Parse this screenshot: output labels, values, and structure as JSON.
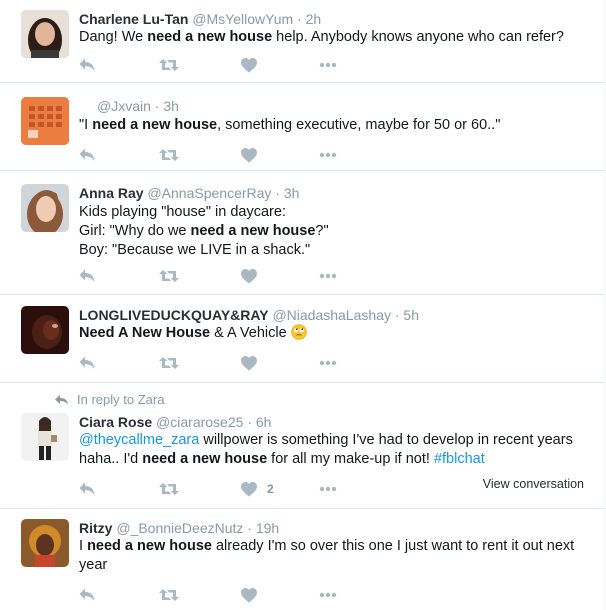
{
  "tweets": [
    {
      "fullname": "Charlene Lu-Tan",
      "handle": "@MsYellowYum",
      "separator": "·",
      "time": "2h",
      "body": [
        {
          "t": "Dang! We "
        },
        {
          "t": "need a new house",
          "b": true
        },
        {
          "t": " help. Anybody knows anyone who can refer?"
        }
      ],
      "icons": [
        "reply-icon",
        "retweet-icon",
        "heart-icon",
        "more-icon"
      ]
    },
    {
      "fullname": "",
      "handle": "@Jxvain",
      "separator": "·",
      "time": "3h",
      "body": [
        {
          "t": "\"I "
        },
        {
          "t": "need a new house",
          "b": true
        },
        {
          "t": ", something executive, maybe for 50 or 60..\""
        }
      ],
      "icons": [
        "reply-icon",
        "retweet-icon",
        "heart-icon",
        "more-icon"
      ]
    },
    {
      "fullname": "Anna Ray",
      "handle": "@AnnaSpencerRay",
      "separator": "·",
      "time": "3h",
      "body_lines": [
        [
          {
            "t": "Kids playing \"house\" in daycare:"
          }
        ],
        [
          {
            "t": "Girl: \"Why do we "
          },
          {
            "t": "need a new house",
            "b": true
          },
          {
            "t": "?\""
          }
        ],
        [
          {
            "t": "Boy: \"Because we LIVE in a shack.\""
          }
        ]
      ],
      "icons": [
        "reply-icon",
        "retweet-icon",
        "heart-icon",
        "more-icon"
      ]
    },
    {
      "fullname": "LONGLIVEDUCKQUAY&RAY",
      "handle": "@NiadashaLashay",
      "separator": "·",
      "time": "5h",
      "body": [
        {
          "t": "Need A New House",
          "b": true
        },
        {
          "t": " & A Vehicle "
        }
      ],
      "emoji": "rolling-eyes-emoji",
      "icons": [
        "reply-icon",
        "retweet-icon",
        "heart-icon",
        "more-icon"
      ]
    },
    {
      "context": "In reply to Zara",
      "fullname": "Ciara Rose",
      "handle": "@ciararose25",
      "separator": "·",
      "time": "6h",
      "body": [
        {
          "t": "@theycallme_zara",
          "link": true
        },
        {
          "t": " willpower is something I've had to develop in recent years haha.. I'd "
        },
        {
          "t": "need a new house",
          "b": true
        },
        {
          "t": " for all my make-up if not! "
        },
        {
          "t": "#fblchat",
          "link": true
        }
      ],
      "like_count": "2",
      "view_conversation": "View conversation",
      "icons": [
        "reply-icon",
        "retweet-icon",
        "heart-icon",
        "more-icon"
      ]
    },
    {
      "fullname": "Ritzy",
      "handle": "@_BonnieDeezNutz",
      "separator": "·",
      "time": "19h",
      "body": [
        {
          "t": "I "
        },
        {
          "t": "need a new house",
          "b": true
        },
        {
          "t": " already I'm so over this one I just want to rent it out next year"
        }
      ],
      "icons": [
        "reply-icon",
        "retweet-icon",
        "heart-icon",
        "more-icon"
      ]
    }
  ],
  "colors": {
    "icon": "#aab8c2",
    "muted": "#8899a6",
    "link": "#1b95e0",
    "border": "#e1e8ed",
    "emoji": "#f7c531"
  }
}
